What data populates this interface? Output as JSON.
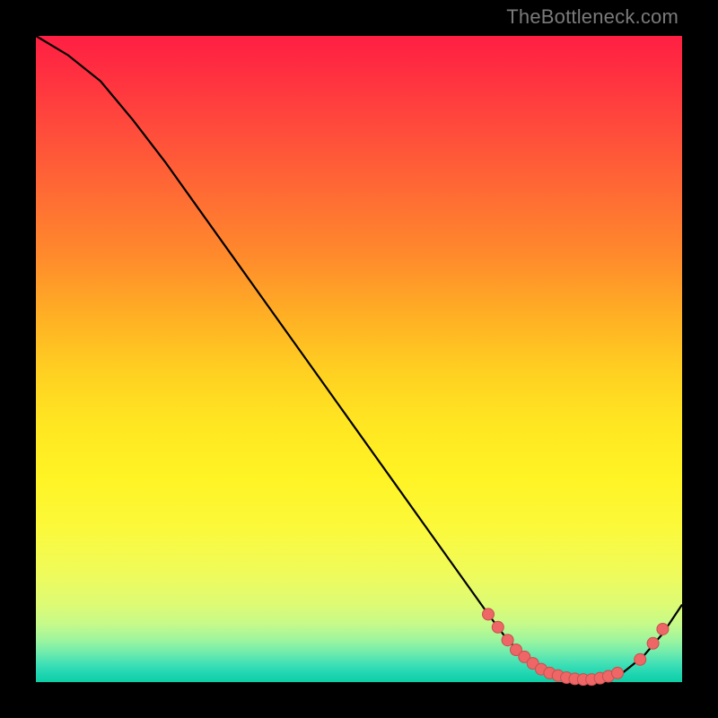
{
  "watermark": {
    "text": "TheBottleneck.com"
  },
  "colors": {
    "background": "#000000",
    "curve_stroke": "#000000",
    "marker_fill": "#ee6666",
    "marker_stroke": "#c94f4f"
  },
  "chart_data": {
    "type": "line",
    "title": "",
    "xlabel": "",
    "ylabel": "",
    "xlim": [
      0,
      100
    ],
    "ylim": [
      0,
      100
    ],
    "grid": false,
    "legend": false,
    "series": [
      {
        "name": "bottleneck-curve",
        "x": [
          0,
          5,
          10,
          15,
          20,
          25,
          30,
          35,
          40,
          45,
          50,
          55,
          60,
          65,
          70,
          73,
          76,
          79,
          82,
          85,
          88,
          91,
          94,
          97,
          100
        ],
        "values": [
          100,
          97,
          93,
          87,
          80.5,
          73.5,
          66.5,
          59.5,
          52.5,
          45.5,
          38.5,
          31.5,
          24.5,
          17.5,
          10.5,
          6.5,
          3.7,
          1.8,
          0.8,
          0.4,
          0.5,
          1.6,
          4.0,
          7.5,
          12.0
        ]
      }
    ],
    "markers": [
      {
        "x": 70.0,
        "y": 10.5
      },
      {
        "x": 71.5,
        "y": 8.5
      },
      {
        "x": 73.0,
        "y": 6.5
      },
      {
        "x": 74.3,
        "y": 5.0
      },
      {
        "x": 75.6,
        "y": 3.9
      },
      {
        "x": 76.9,
        "y": 2.9
      },
      {
        "x": 78.2,
        "y": 2.0
      },
      {
        "x": 79.5,
        "y": 1.4
      },
      {
        "x": 80.8,
        "y": 1.0
      },
      {
        "x": 82.1,
        "y": 0.7
      },
      {
        "x": 83.4,
        "y": 0.5
      },
      {
        "x": 84.7,
        "y": 0.4
      },
      {
        "x": 86.0,
        "y": 0.4
      },
      {
        "x": 87.3,
        "y": 0.6
      },
      {
        "x": 88.6,
        "y": 0.9
      },
      {
        "x": 90.0,
        "y": 1.4
      },
      {
        "x": 93.5,
        "y": 3.5
      },
      {
        "x": 95.5,
        "y": 6.0
      },
      {
        "x": 97.0,
        "y": 8.2
      }
    ]
  }
}
